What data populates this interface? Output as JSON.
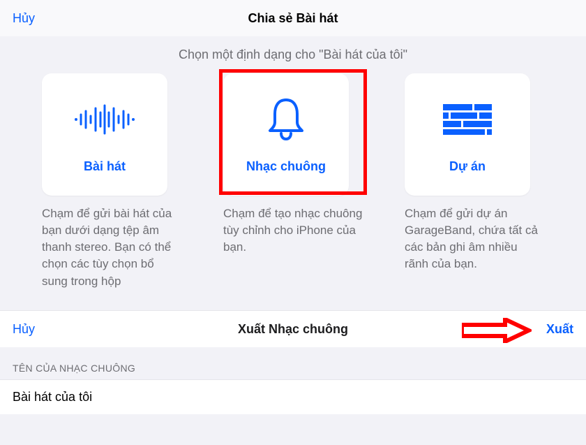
{
  "colors": {
    "accent": "#0a60ff",
    "highlight": "#ff0000"
  },
  "share_nav": {
    "cancel": "Hủy",
    "title": "Chia sẻ Bài hát"
  },
  "instruction": "Chọn một định dạng cho \"Bài hát của tôi\"",
  "cards": {
    "song": {
      "label": "Bài hát",
      "desc": "Chạm để gửi bài hát của bạn dưới dạng tệp âm thanh stereo. Bạn có thể chọn các tùy chọn bổ sung trong hộp"
    },
    "ringtone": {
      "label": "Nhạc chuông",
      "desc": "Chạm để tạo nhạc chuông tùy chỉnh cho iPhone của bạn."
    },
    "project": {
      "label": "Dự án",
      "desc": "Chạm để gửi dự án GarageBand, chứa tất cả các bản ghi âm nhiều rãnh của bạn."
    }
  },
  "export_nav": {
    "cancel": "Hủy",
    "title": "Xuất Nhạc chuông",
    "action": "Xuất"
  },
  "form": {
    "section_header": "TÊN CỦA NHẠC CHUÔNG",
    "ringtone_name": "Bài hát của tôi"
  }
}
